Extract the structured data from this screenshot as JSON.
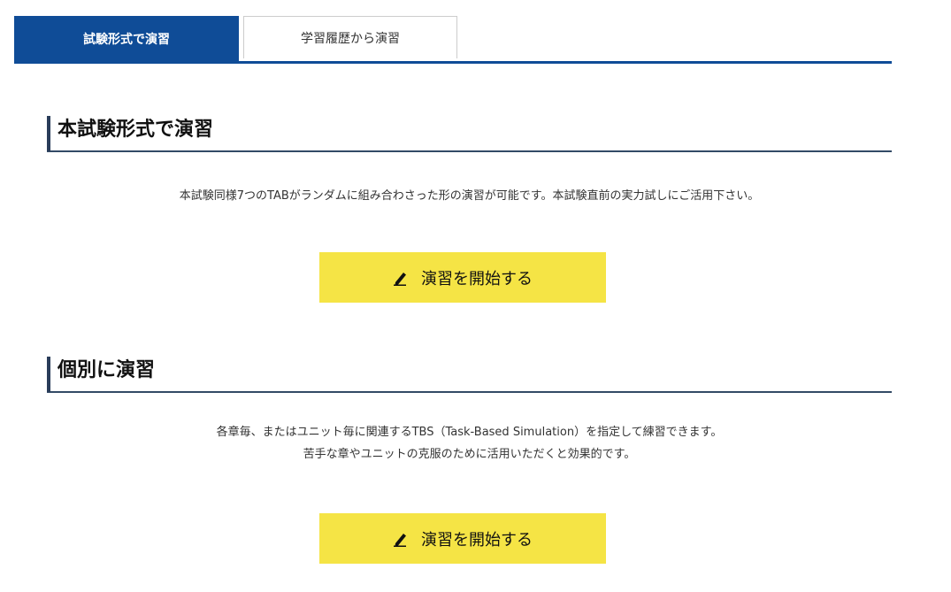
{
  "tabs": [
    {
      "label": "試験形式で演習",
      "active": true
    },
    {
      "label": "学習履歴から演習",
      "active": false
    }
  ],
  "sections": [
    {
      "title": "本試験形式で演習",
      "description": [
        "本試験同様7つのTABがランダムに組み合わさった形の演習が可能です。本試験直前の実力試しにご活用下さい。"
      ],
      "button_label": "演習を開始する",
      "button_icon": "pencil-icon"
    },
    {
      "title": "個別に演習",
      "description": [
        "各章毎、またはユニット毎に関連するTBS（Task-Based Simulation）を指定して練習できます。",
        "苦手な章やユニットの克服のために活用いただくと効果的です。"
      ],
      "button_label": "演習を開始する",
      "button_icon": "pencil-icon"
    }
  ],
  "colors": {
    "primary": "#0f4c97",
    "button": "#f5e445",
    "heading_rule": "#334a66"
  }
}
